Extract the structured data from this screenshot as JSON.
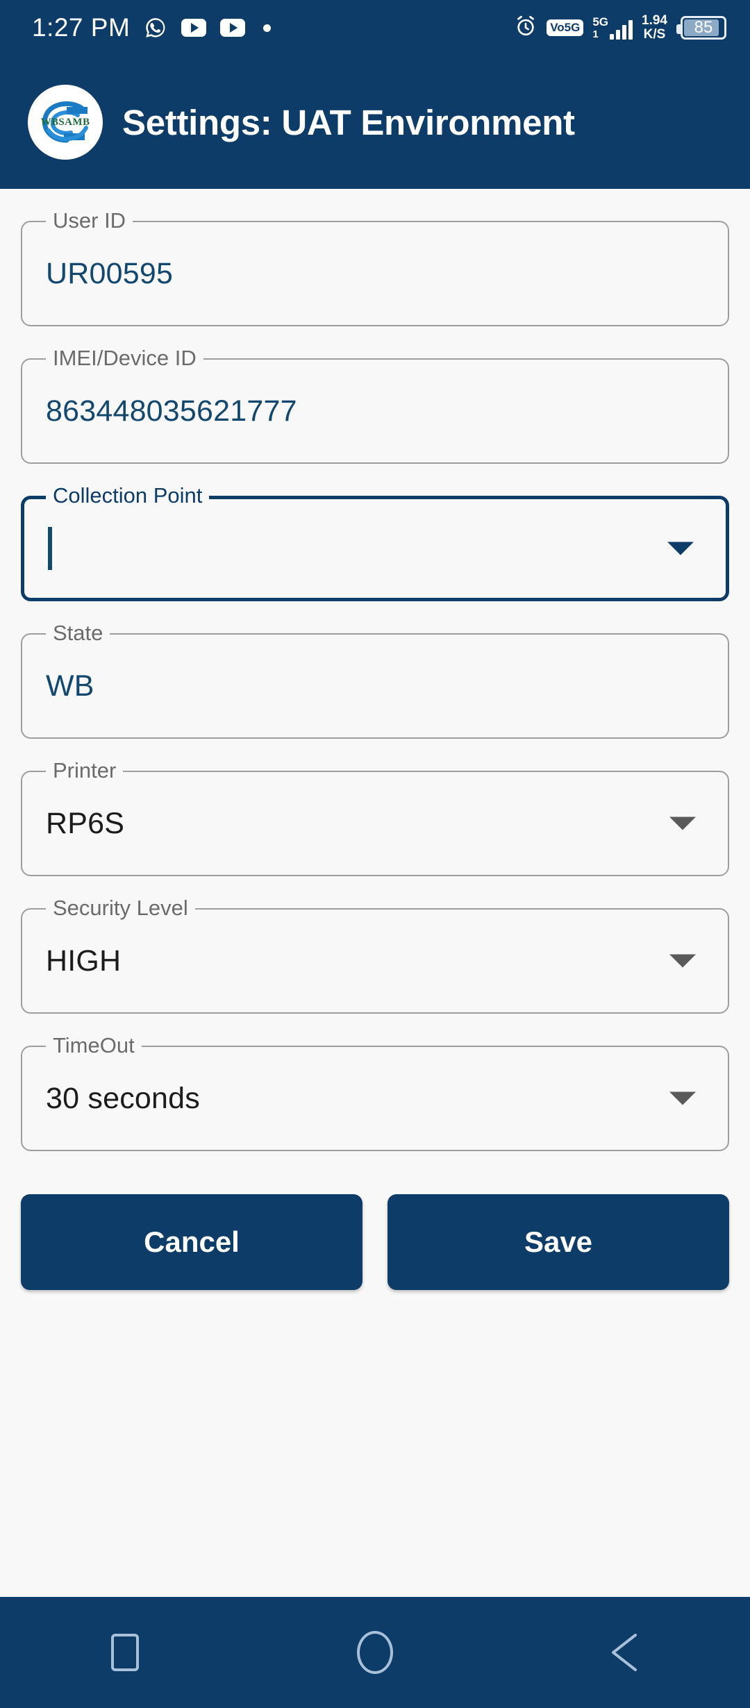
{
  "statusbar": {
    "time": "1:27 PM",
    "icons": [
      "whatsapp-icon",
      "youtube-icon",
      "youtube-icon",
      "dot-indicator"
    ],
    "alarm": "alarm-icon",
    "volte_badge": "Vo5G",
    "network_type": "5G",
    "network_sub": "1",
    "data_rate": "1.94",
    "data_rate_unit": "K/S",
    "battery_level": "85"
  },
  "header": {
    "logo_text": "WBSAMB",
    "title": "Settings: UAT Environment"
  },
  "form": {
    "fields": [
      {
        "label": "User ID",
        "value": "UR00595",
        "value_style": "blue",
        "dropdown": false,
        "focused": false
      },
      {
        "label": "IMEI/Device ID",
        "value": "863448035621777",
        "value_style": "blue",
        "dropdown": false,
        "focused": false
      },
      {
        "label": "Collection Point",
        "value": "",
        "value_style": "blue",
        "dropdown": true,
        "focused": true
      },
      {
        "label": "State",
        "value": "WB",
        "value_style": "blue",
        "dropdown": false,
        "focused": false
      },
      {
        "label": "Printer",
        "value": "RP6S",
        "value_style": "dark",
        "dropdown": true,
        "focused": false
      },
      {
        "label": "Security Level",
        "value": "HIGH",
        "value_style": "dark",
        "dropdown": true,
        "focused": false
      },
      {
        "label": "TimeOut",
        "value": "30 seconds",
        "value_style": "dark",
        "dropdown": true,
        "focused": false
      }
    ]
  },
  "buttons": {
    "cancel_label": "Cancel",
    "save_label": "Save"
  },
  "navbar": {
    "recents_label": "recents",
    "home_label": "home",
    "back_label": "back"
  },
  "colors": {
    "brand_navy": "#0d3c68",
    "page_bg": "#f8f8f8",
    "value_blue": "#12486f",
    "border_gray": "#9e9e9e"
  }
}
